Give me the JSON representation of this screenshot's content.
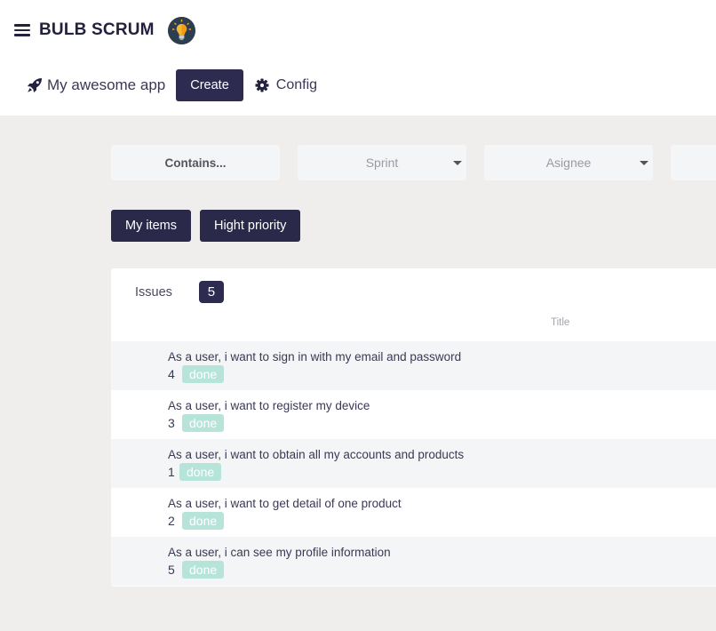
{
  "header": {
    "brand_title": "BULB SCRUM",
    "project_name": "My awesome app",
    "create_label": "Create",
    "config_label": "Config",
    "icons": {
      "menu": "hamburger-icon",
      "logo": "lightbulb-logo",
      "project": "rocket-icon",
      "config": "gear-icon"
    }
  },
  "filters": {
    "contains_placeholder": "Contains...",
    "sprint_placeholder": "Sprint",
    "assignee_placeholder": "Asignee"
  },
  "quick_filters": {
    "my_items_label": "My items",
    "high_priority_label": "Hight priority"
  },
  "issues": {
    "label": "Issues",
    "count": "5",
    "column_title": "Title",
    "rows": [
      {
        "title": "As a user, i want to sign in with my email and password",
        "id": "4",
        "status": "done"
      },
      {
        "title": "As a user, i want to register my device",
        "id": "3",
        "status": "done"
      },
      {
        "title": "As a user, i want to obtain all my accounts and products",
        "id": "1",
        "status": "done"
      },
      {
        "title": "As a user, i want to get detail of one product",
        "id": "2",
        "status": "done"
      },
      {
        "title": "As a user, i can see my profile information",
        "id": "5",
        "status": "done"
      }
    ]
  },
  "colors": {
    "primary": "#2d2c50",
    "status_done": "#b6e4d8",
    "page_background": "#efeeec"
  }
}
